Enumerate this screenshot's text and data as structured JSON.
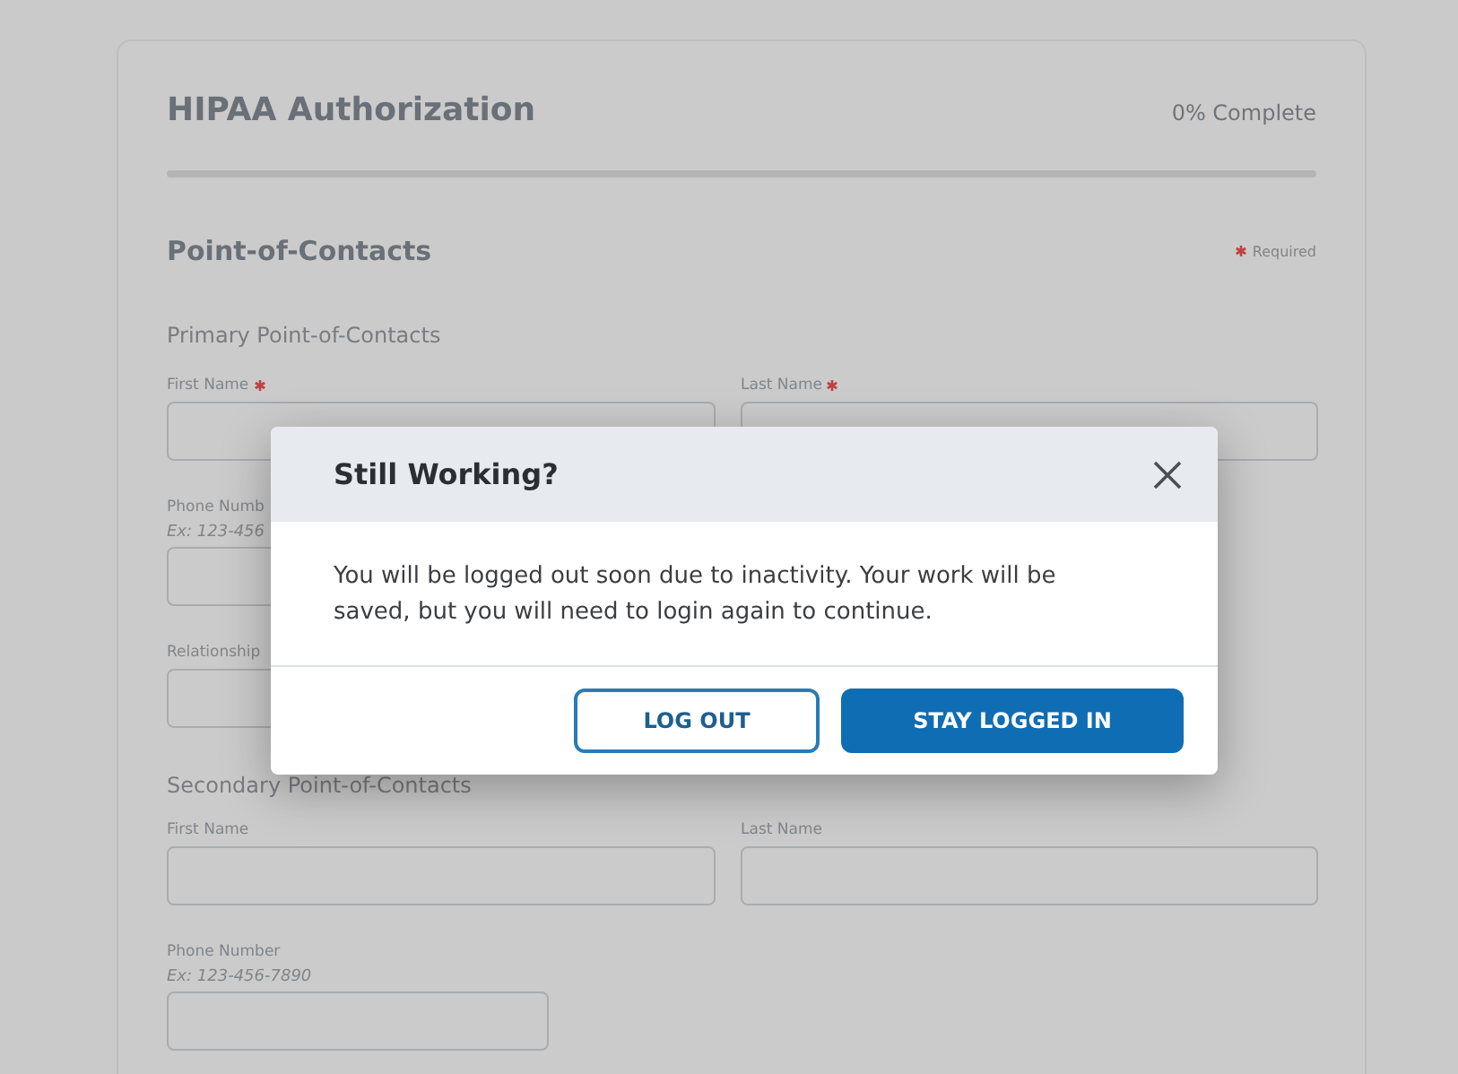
{
  "form": {
    "title": "HIPAA Authorization",
    "progress_text": "0% Complete",
    "progress": {
      "level": 0
    },
    "section_title": "Point-of-Contacts",
    "required_legend": "Required",
    "groups": [
      {
        "title": "Primary Point-of-Contacts",
        "rows": [
          [
            {
              "label": "First Name",
              "required": true
            },
            {
              "label": "Last Name",
              "required": true
            }
          ],
          [
            {
              "label": "Phone Numb",
              "hint": "Ex: 123-456",
              "required": false
            }
          ],
          [
            {
              "label": "Relationship",
              "required": false
            }
          ]
        ]
      },
      {
        "title": "Secondary Point-of-Contacts",
        "rows": [
          [
            {
              "label": "First Name",
              "required": false
            },
            {
              "label": "Last Name",
              "required": false
            }
          ],
          [
            {
              "label": "Phone Number",
              "hint": "Ex: 123-456-7890",
              "required": false
            }
          ]
        ]
      }
    ]
  },
  "dialog": {
    "title": "Still Working?",
    "message": "You will be logged out soon due to inactivity. Your work will be saved, but you will need to login again to continue.",
    "buttons": [
      {
        "label": "LOG OUT",
        "kind": "secondary"
      },
      {
        "label": "STAY LOGGED IN",
        "kind": "primary"
      }
    ]
  }
}
